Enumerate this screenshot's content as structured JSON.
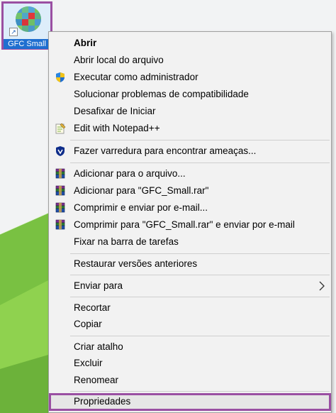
{
  "desktop_icon": {
    "label": "GFC Small",
    "icon": "gfc-app-icon",
    "shortcut_overlay": "shortcut-arrow-icon"
  },
  "menu": {
    "items": [
      {
        "label": "Abrir",
        "icon": null,
        "bold": true
      },
      {
        "label": "Abrir local do arquivo",
        "icon": null
      },
      {
        "label": "Executar como administrador",
        "icon": "uac-shield-icon"
      },
      {
        "label": "Solucionar problemas de compatibilidade",
        "icon": null
      },
      {
        "label": "Desafixar de Iniciar",
        "icon": null
      },
      {
        "label": "Edit with Notepad++",
        "icon": "notepadpp-icon"
      },
      {
        "label": "Fazer varredura para encontrar ameaças...",
        "icon": "defender-shield-icon"
      },
      {
        "label": "Adicionar para o arquivo...",
        "icon": "winrar-icon"
      },
      {
        "label": "Adicionar para \"GFC_Small.rar\"",
        "icon": "winrar-icon"
      },
      {
        "label": "Comprimir e enviar por e-mail...",
        "icon": "winrar-icon"
      },
      {
        "label": "Comprimir para \"GFC_Small.rar\" e enviar por e-mail",
        "icon": "winrar-icon"
      },
      {
        "label": "Fixar na barra de tarefas",
        "icon": null
      },
      {
        "label": "Restaurar versões anteriores",
        "icon": null
      },
      {
        "label": "Enviar para",
        "icon": null,
        "submenu": true
      },
      {
        "label": "Recortar",
        "icon": null
      },
      {
        "label": "Copiar",
        "icon": null
      },
      {
        "label": "Criar atalho",
        "icon": null
      },
      {
        "label": "Excluir",
        "icon": null
      },
      {
        "label": "Renomear",
        "icon": null
      },
      {
        "label": "Propriedades",
        "icon": null,
        "highlighted": true
      }
    ]
  },
  "colors": {
    "highlight_border": "#9a4fa2",
    "menu_background": "#f2f2f2",
    "desktop_green": "#7bc043"
  }
}
